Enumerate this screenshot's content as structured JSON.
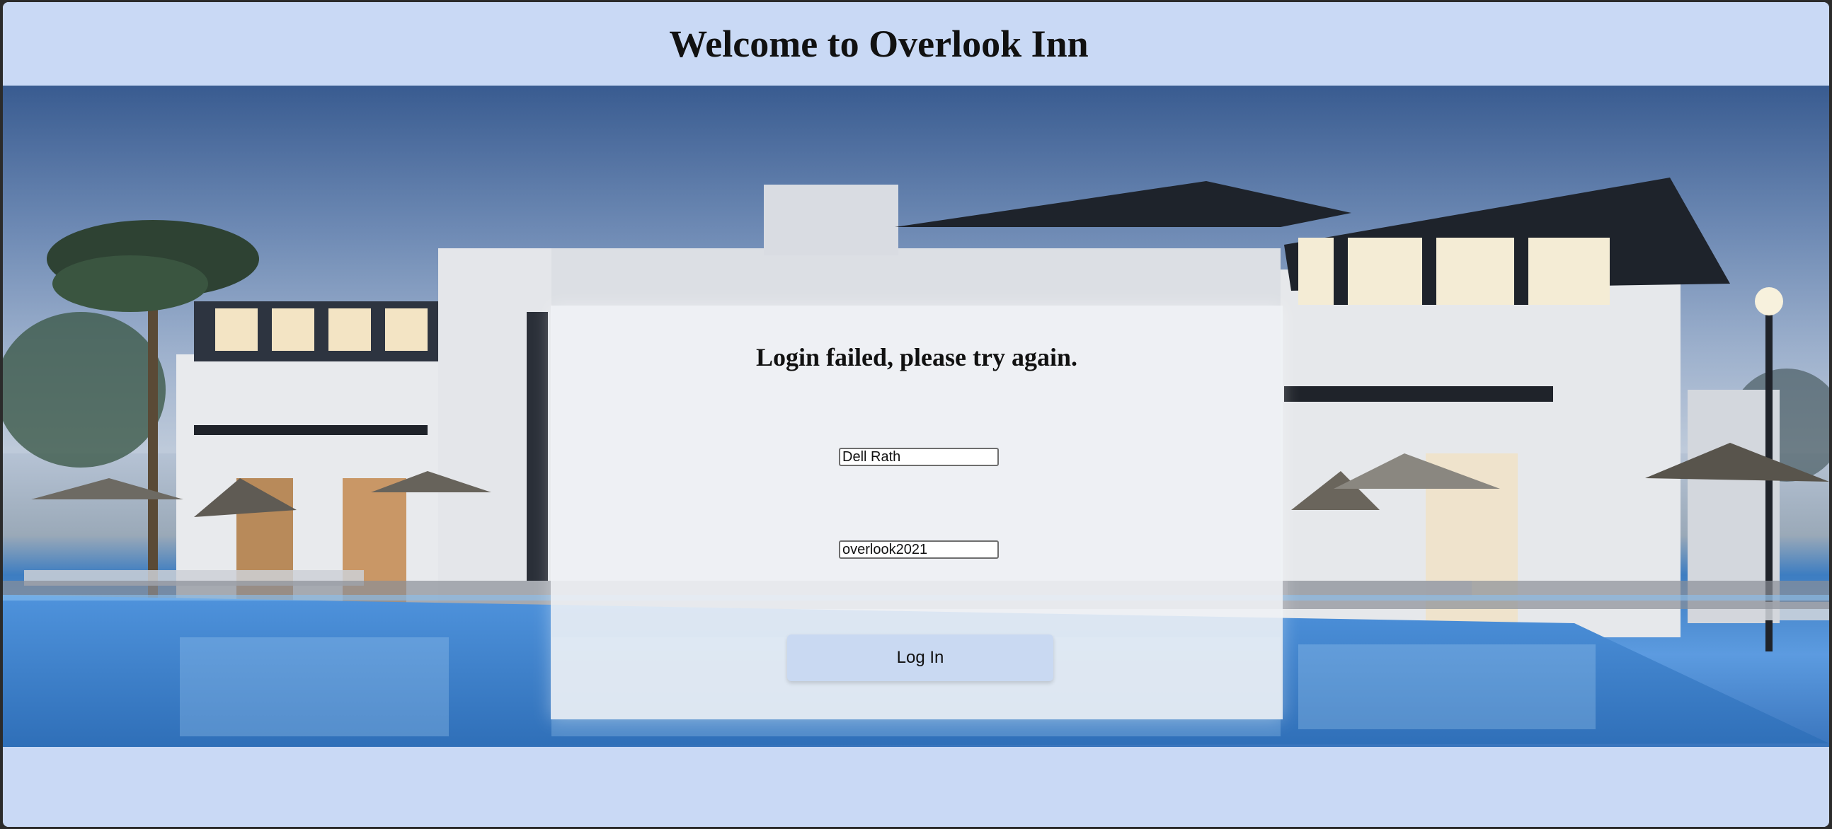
{
  "header": {
    "title": "Welcome to Overlook Inn"
  },
  "login": {
    "message": "Login failed, please try again.",
    "username_value": "Dell Rath",
    "password_value": "overlook2021",
    "button_label": "Log In"
  },
  "colors": {
    "page_background": "#c9d9f5",
    "button_background": "#c9d9f2",
    "card_background": "#f0f2f6"
  }
}
